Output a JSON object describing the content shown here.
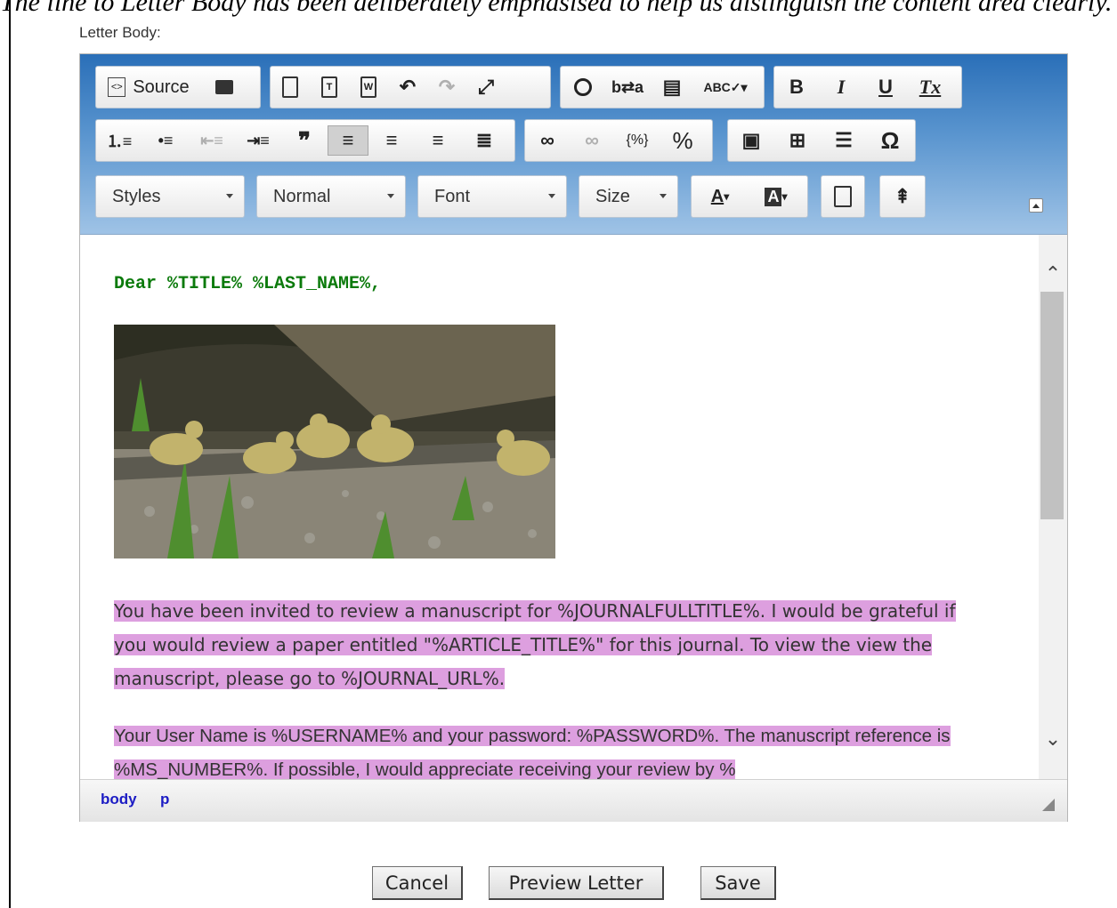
{
  "caption": "The line to Letter Body has been deliberately emphasised to help us distinguish the content area clearly.",
  "letter_label": "Letter Body:",
  "toolbar": {
    "row1": [
      {
        "icon": "source-icon",
        "glyph": "⊡",
        "label": "Source"
      },
      {
        "icon": "print-icon",
        "glyph": "🖶"
      },
      {
        "icon": "paste-icon",
        "glyph": "📋"
      },
      {
        "icon": "paste-text-icon",
        "glyph": "📋"
      },
      {
        "icon": "paste-word-icon",
        "glyph": "📋"
      },
      {
        "icon": "undo-icon",
        "glyph": "↶"
      },
      {
        "icon": "redo-icon",
        "glyph": "↷"
      },
      {
        "icon": "maximize-icon",
        "glyph": "⤢"
      },
      {
        "icon": "find-icon",
        "glyph": "🔍"
      },
      {
        "icon": "replace-icon",
        "glyph": "↹"
      },
      {
        "icon": "select-all-icon",
        "glyph": "▤"
      },
      {
        "icon": "spellcheck-icon",
        "glyph": "✓"
      },
      {
        "icon": "bold-icon",
        "glyph": "B"
      },
      {
        "icon": "italic-icon",
        "glyph": "I"
      },
      {
        "icon": "underline-icon",
        "glyph": "U"
      },
      {
        "icon": "remove-format-icon",
        "glyph": "Tx"
      }
    ],
    "row2": [
      {
        "icon": "numbered-list-icon",
        "glyph": "≔"
      },
      {
        "icon": "bulleted-list-icon",
        "glyph": "☰"
      },
      {
        "icon": "outdent-icon",
        "glyph": "⇤"
      },
      {
        "icon": "indent-icon",
        "glyph": "⇥"
      },
      {
        "icon": "blockquote-icon",
        "glyph": "❞"
      },
      {
        "icon": "align-left-icon",
        "glyph": "≡"
      },
      {
        "icon": "align-center-icon",
        "glyph": "≡"
      },
      {
        "icon": "align-right-icon",
        "glyph": "≡"
      },
      {
        "icon": "justify-icon",
        "glyph": "≣"
      },
      {
        "icon": "link-icon",
        "glyph": "∞"
      },
      {
        "icon": "unlink-icon",
        "glyph": "∞"
      },
      {
        "icon": "placeholder-icon",
        "glyph": "{%}"
      },
      {
        "icon": "percent-icon",
        "glyph": "%"
      },
      {
        "icon": "image-icon",
        "glyph": "▣"
      },
      {
        "icon": "table-icon",
        "glyph": "⊞"
      },
      {
        "icon": "horizontal-line-icon",
        "glyph": "☰"
      },
      {
        "icon": "special-char-icon",
        "glyph": "Ω"
      }
    ],
    "styles_label": "Styles",
    "format_label": "Normal",
    "font_label": "Font",
    "size_label": "Size",
    "text_color_glyph": "A",
    "bg_color_glyph": "A"
  },
  "content": {
    "dear_line": "Dear %TITLE% %LAST_NAME%,",
    "paragraph1": "You have been invited to review a manuscript for %JOURNALFULLTITLE%. I would be grateful if you would review a paper entitled \"%ARTICLE_TITLE%\" for this journal. To view the view the manuscript, please go to %JOURNAL_URL%.",
    "paragraph2": "Your User Name is %USERNAME% and your password: %PASSWORD%. The manuscript reference is %MS_NUMBER%. If possible, I would appreciate receiving your review by %"
  },
  "statusbar": {
    "path": [
      "body",
      "p"
    ]
  },
  "buttons": {
    "cancel": "Cancel",
    "preview": "Preview Letter",
    "save": "Save"
  }
}
